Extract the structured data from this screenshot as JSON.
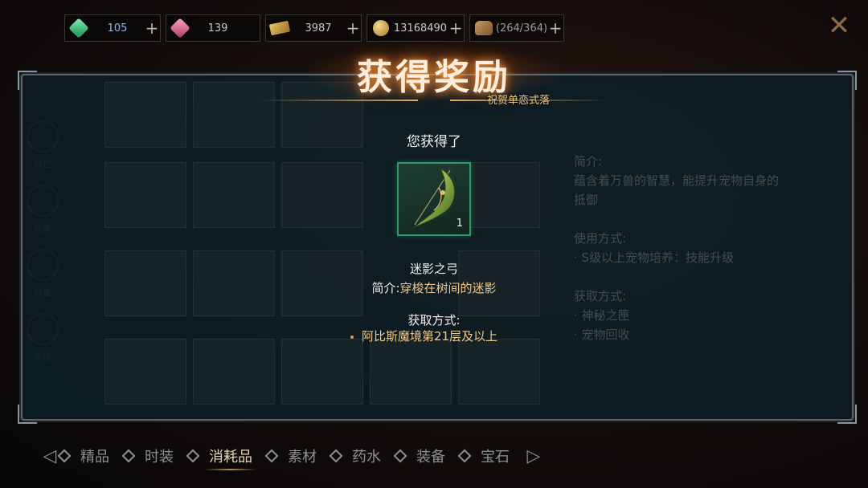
{
  "currency": [
    {
      "icon": "green-gem-icon",
      "value": "105",
      "blue": true
    },
    {
      "icon": "pink-gem-icon",
      "value": "139",
      "blue": false
    },
    {
      "icon": "gold-ticket-icon",
      "value": "3987",
      "blue": false
    },
    {
      "icon": "gold-coins-icon",
      "value": "13168490",
      "blue": false
    },
    {
      "icon": "bag-capacity-icon",
      "value": "(264/364)",
      "blue": false
    }
  ],
  "reward": {
    "title": "获得奖励",
    "subtitle": "祝贺单恋式落",
    "you_got": "您获得了",
    "item_count": "1",
    "item_name": "迷影之弓",
    "desc_label": "简介:",
    "desc_text": "穿梭在树间的迷影",
    "obtain_heading": "获取方式:",
    "obtain_item": "阿比斯魔境第21层及以上"
  },
  "side_tabs": [
    "背包",
    "仓库",
    "装备",
    "合成"
  ],
  "right_info": [
    "简介:",
    "蕴含着万兽的智慧，能提升宠物自身的",
    "抵御",
    "",
    "使用方式:",
    "· S级以上宠物培养：技能升级",
    "",
    "获取方式:",
    "· 神秘之匣",
    "· 宠物回收"
  ],
  "bottom_tabs": [
    {
      "label": "精品",
      "active": false
    },
    {
      "label": "时装",
      "active": false
    },
    {
      "label": "消耗品",
      "active": true
    },
    {
      "label": "素材",
      "active": false
    },
    {
      "label": "药水",
      "active": false
    },
    {
      "label": "装备",
      "active": false
    },
    {
      "label": "宝石",
      "active": false
    }
  ],
  "colors": {
    "accent_gold": "#f0c98a",
    "item_border": "#2f9a68",
    "panel": "#0c1e26"
  }
}
